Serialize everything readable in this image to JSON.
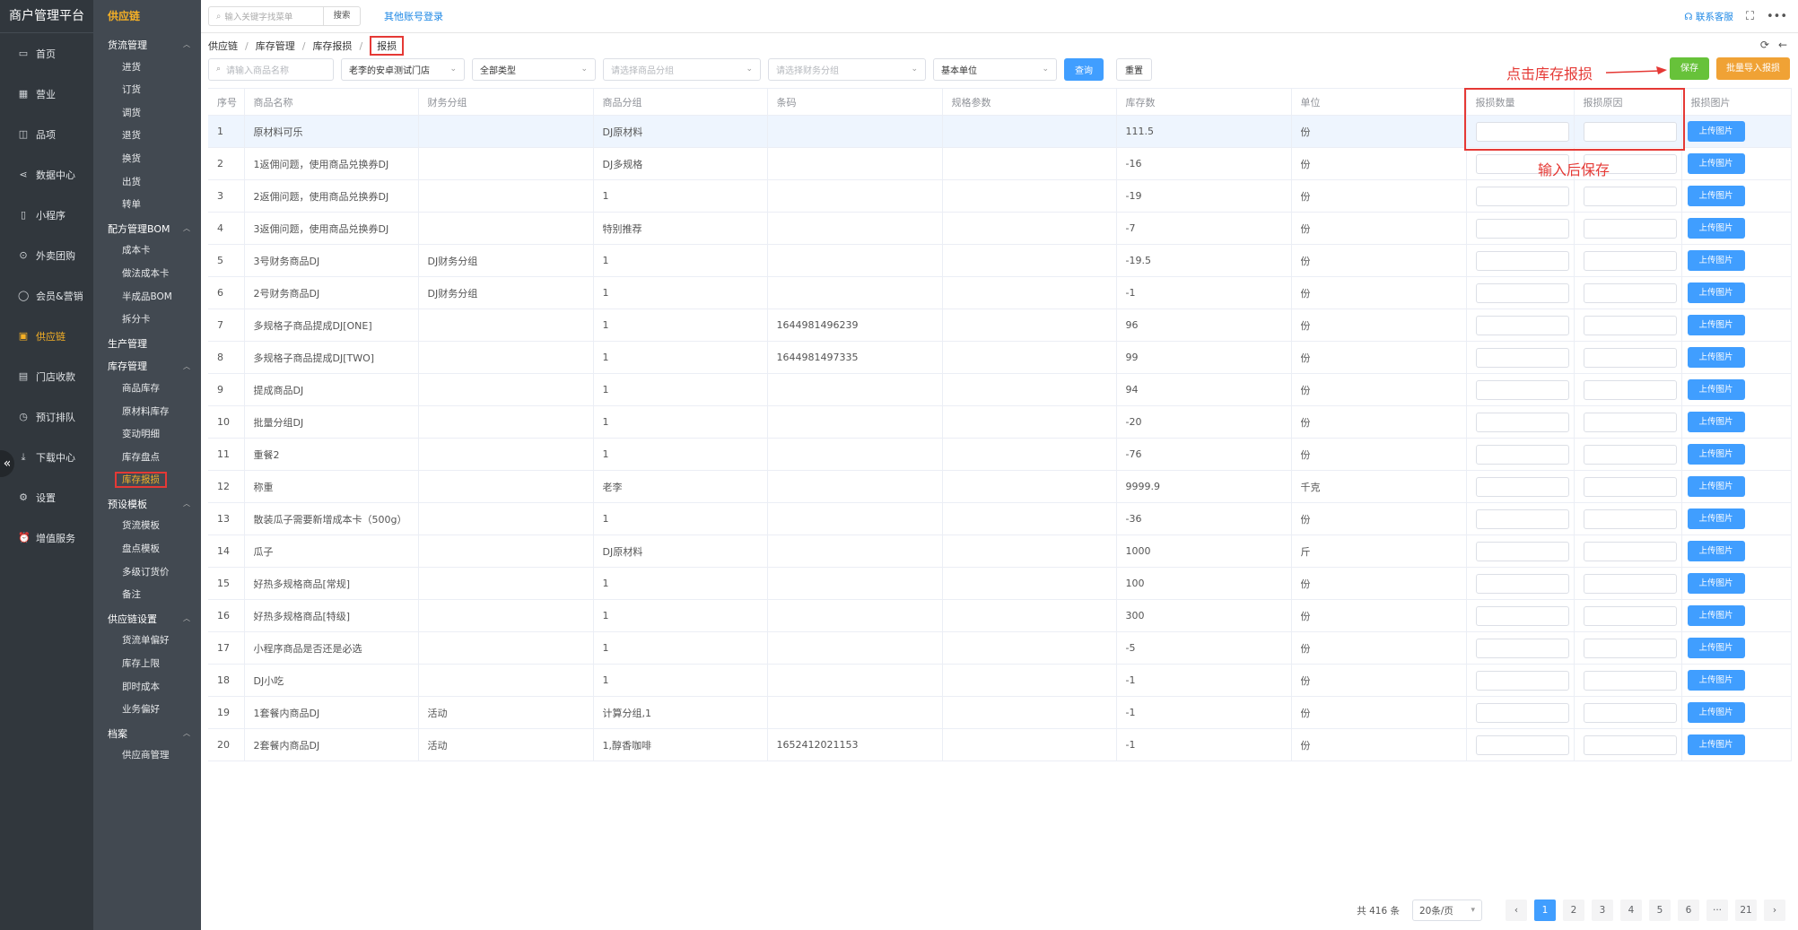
{
  "brand": "商户管理平台",
  "nav": [
    {
      "label": "首页",
      "icon": "monitor-icon",
      "glyph": "▭"
    },
    {
      "label": "营业",
      "icon": "calendar-icon",
      "glyph": "▦"
    },
    {
      "label": "品项",
      "icon": "bag-icon",
      "glyph": "◫"
    },
    {
      "label": "数据中心",
      "icon": "share-icon",
      "glyph": "⋖"
    },
    {
      "label": "小程序",
      "icon": "phone-icon",
      "glyph": "▯"
    },
    {
      "label": "外卖团购",
      "icon": "bike-icon",
      "glyph": "⊙"
    },
    {
      "label": "会员&营销",
      "icon": "user-icon",
      "glyph": "◯"
    },
    {
      "label": "供应链",
      "icon": "truck-icon",
      "glyph": "▣"
    },
    {
      "label": "门店收款",
      "icon": "database-icon",
      "glyph": "▤"
    },
    {
      "label": "预订排队",
      "icon": "clock-icon",
      "glyph": "◷"
    },
    {
      "label": "下载中心",
      "icon": "download-icon",
      "glyph": "⤓"
    },
    {
      "label": "设置",
      "icon": "gear-icon",
      "glyph": "⚙"
    },
    {
      "label": "增值服务",
      "icon": "alarm-icon",
      "glyph": "⏰"
    }
  ],
  "nav_active_index": 7,
  "sub_nav": {
    "title": "供应链",
    "groups": [
      {
        "label": "货流管理",
        "expanded": true,
        "items": [
          "进货",
          "订货",
          "调货",
          "退货",
          "换货",
          "出货",
          "转单"
        ]
      },
      {
        "label": "配方管理BOM",
        "expanded": true,
        "items": [
          "成本卡",
          "做法成本卡",
          "半成品BOM",
          "拆分卡"
        ]
      },
      {
        "label": "生产管理",
        "expanded": false,
        "items": []
      },
      {
        "label": "库存管理",
        "expanded": true,
        "items": [
          "商品库存",
          "原材料库存",
          "变动明细",
          "库存盘点",
          "库存报损"
        ]
      },
      {
        "label": "预设模板",
        "expanded": true,
        "items": [
          "货流模板",
          "盘点模板",
          "多级订货价",
          "备注"
        ]
      },
      {
        "label": "供应链设置",
        "expanded": true,
        "items": [
          "货流单偏好",
          "库存上限",
          "即时成本",
          "业务偏好"
        ]
      },
      {
        "label": "档案",
        "expanded": true,
        "items": [
          "供应商管理"
        ]
      }
    ],
    "active_item": "库存报损"
  },
  "topbar": {
    "search_placeholder": "输入关键字找菜单",
    "search_button": "搜索",
    "other_login": "其他账号登录",
    "support": "联系客服"
  },
  "breadcrumb": [
    "供应链",
    "库存管理",
    "库存报损",
    "报损"
  ],
  "filters": [
    {
      "text": "请输入商品名称",
      "placeholder": true,
      "icon": "search-icon",
      "width": 140
    },
    {
      "text": "老李的安卓测试门店",
      "placeholder": false,
      "icon": "chevron-down-icon",
      "width": 138
    },
    {
      "text": "全部类型",
      "placeholder": false,
      "icon": "chevron-down-icon",
      "width": 138
    },
    {
      "text": "请选择商品分组",
      "placeholder": true,
      "icon": "chevron-down-icon",
      "width": 176
    },
    {
      "text": "请选择财务分组",
      "placeholder": true,
      "icon": "chevron-down-icon",
      "width": 176
    },
    {
      "text": "基本单位",
      "placeholder": false,
      "icon": "chevron-down-icon",
      "width": 138
    }
  ],
  "query_button": "查询",
  "reset_button": "重置",
  "save_button": "保存",
  "import_button": "批量导入报损",
  "annotation_click": "点击库存报损",
  "annotation_save": "输入后保存",
  "columns": [
    "序号",
    "商品名称",
    "财务分组",
    "商品分组",
    "条码",
    "规格参数",
    "库存数",
    "单位",
    "报损数量",
    "报损原因",
    "报损图片"
  ],
  "upload_label": "上传图片",
  "rows": [
    [
      "1",
      "原材料可乐",
      "",
      "DJ原材料",
      "",
      "",
      "111.5",
      "份"
    ],
    [
      "2",
      "1返佣问题，使用商品兑换券DJ",
      "",
      "DJ多规格",
      "",
      "",
      "-16",
      "份"
    ],
    [
      "3",
      "2返佣问题，使用商品兑换券DJ",
      "",
      "1",
      "",
      "",
      "-19",
      "份"
    ],
    [
      "4",
      "3返佣问题，使用商品兑换券DJ",
      "",
      "特别推荐",
      "",
      "",
      "-7",
      "份"
    ],
    [
      "5",
      "3号财务商品DJ",
      "DJ财务分组",
      "1",
      "",
      "",
      "-19.5",
      "份"
    ],
    [
      "6",
      "2号财务商品DJ",
      "DJ财务分组",
      "1",
      "",
      "",
      "-1",
      "份"
    ],
    [
      "7",
      "多规格子商品提成DJ[ONE]",
      "",
      "1",
      "1644981496239",
      "",
      "96",
      "份"
    ],
    [
      "8",
      "多规格子商品提成DJ[TWO]",
      "",
      "1",
      "1644981497335",
      "",
      "99",
      "份"
    ],
    [
      "9",
      "提成商品DJ",
      "",
      "1",
      "",
      "",
      "94",
      "份"
    ],
    [
      "10",
      "批量分组DJ",
      "",
      "1",
      "",
      "",
      "-20",
      "份"
    ],
    [
      "11",
      "重餐2",
      "",
      "1",
      "",
      "",
      "-76",
      "份"
    ],
    [
      "12",
      "称重",
      "",
      "老李",
      "",
      "",
      "9999.9",
      "千克"
    ],
    [
      "13",
      "散装瓜子需要新增成本卡（500g）",
      "",
      "1",
      "",
      "",
      "-36",
      "份"
    ],
    [
      "14",
      "瓜子",
      "",
      "DJ原材料",
      "",
      "",
      "1000",
      "斤"
    ],
    [
      "15",
      "好热多规格商品[常规]",
      "",
      "1",
      "",
      "",
      "100",
      "份"
    ],
    [
      "16",
      "好热多规格商品[特级]",
      "",
      "1",
      "",
      "",
      "300",
      "份"
    ],
    [
      "17",
      "小程序商品是否还是必选",
      "",
      "1",
      "",
      "",
      "-5",
      "份"
    ],
    [
      "18",
      "DJ小吃",
      "",
      "1",
      "",
      "",
      "-1",
      "份"
    ],
    [
      "19",
      "1套餐内商品DJ",
      "活动",
      "计算分组,1",
      "",
      "",
      "-1",
      "份"
    ],
    [
      "20",
      "2套餐内商品DJ",
      "活动",
      "1,醇香咖啡",
      "1652412021153",
      "",
      "-1",
      "份"
    ]
  ],
  "pagination": {
    "total": "共 416 条",
    "page_size": "20条/页",
    "pages": [
      "1",
      "2",
      "3",
      "4",
      "5",
      "6",
      "···",
      "21"
    ],
    "current": "1"
  }
}
